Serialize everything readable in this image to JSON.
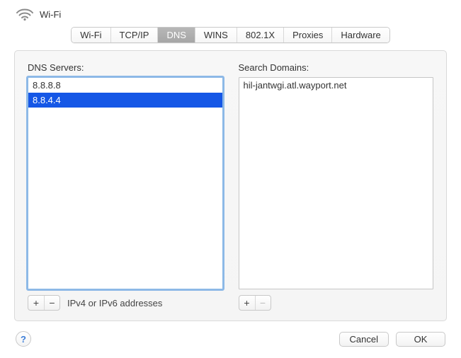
{
  "header": {
    "title": "Wi-Fi"
  },
  "tabs": [
    {
      "label": "Wi-Fi",
      "active": false
    },
    {
      "label": "TCP/IP",
      "active": false
    },
    {
      "label": "DNS",
      "active": true
    },
    {
      "label": "WINS",
      "active": false
    },
    {
      "label": "802.1X",
      "active": false
    },
    {
      "label": "Proxies",
      "active": false
    },
    {
      "label": "Hardware",
      "active": false
    }
  ],
  "dns": {
    "label": "DNS Servers:",
    "servers": [
      {
        "value": "8.8.8.8",
        "selected": false
      },
      {
        "value": "8.8.4.4",
        "selected": true
      }
    ],
    "hint": "IPv4 or IPv6 addresses",
    "add_glyph": "+",
    "remove_glyph": "−",
    "remove_disabled": false
  },
  "search": {
    "label": "Search Domains:",
    "domains": [
      {
        "value": "hil-jantwgi.atl.wayport.net",
        "selected": false
      }
    ],
    "add_glyph": "+",
    "remove_glyph": "−",
    "remove_disabled": true
  },
  "buttons": {
    "help_glyph": "?",
    "cancel": "Cancel",
    "ok": "OK"
  }
}
